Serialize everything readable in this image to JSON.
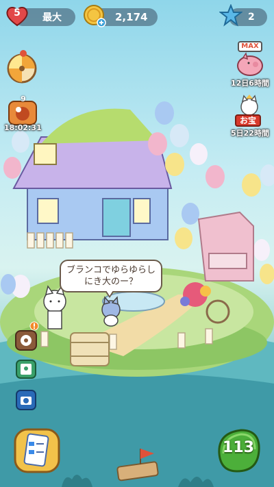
{
  "hud": {
    "lives_count": "5",
    "lives_status": "最大",
    "coins": "2,174",
    "stars": "2"
  },
  "right_side": {
    "piggy_badge": "MAX",
    "piggy_timer": "12日6時間",
    "treasure_label": "お宝",
    "treasure_timer": "5日22時間"
  },
  "left_side": {
    "event_count": "9",
    "event_timer": "18:02:31"
  },
  "dialogue": {
    "line": "ブランコでゆらゆらしにき大のー？"
  },
  "bottom": {
    "energy": "113"
  },
  "colors": {
    "sky": "#8fd6ea",
    "water": "#3e9aa6",
    "energy_button": "#4caf3a",
    "house_roof": "#b9a6e0"
  }
}
